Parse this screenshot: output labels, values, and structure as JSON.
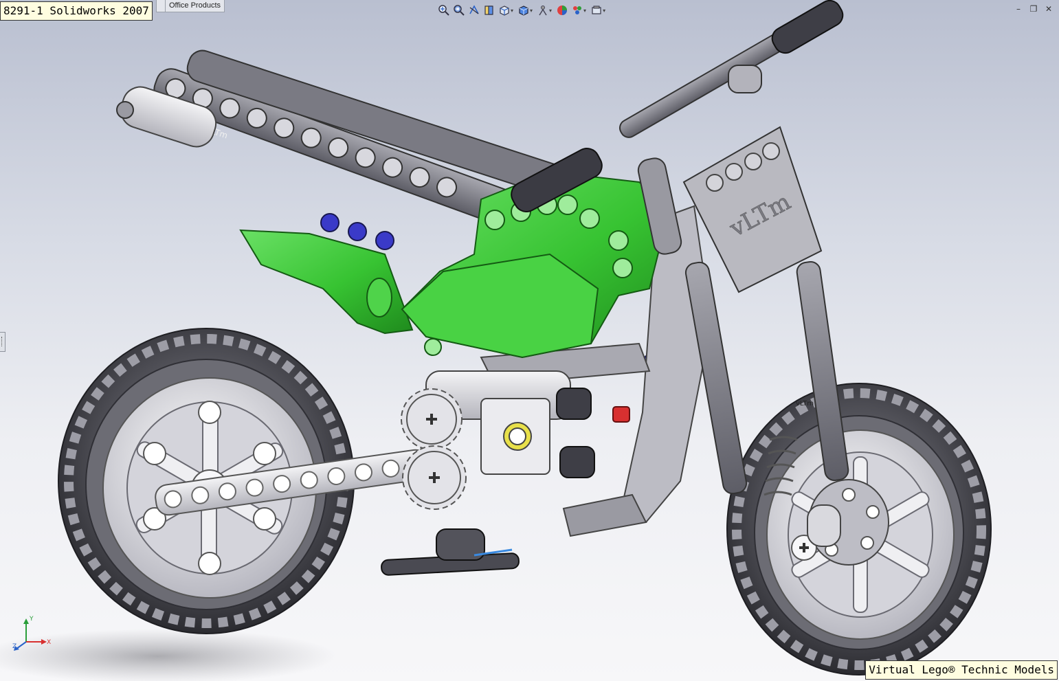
{
  "title_label": "8291-1 Solidworks 2007",
  "tabs": {
    "office_products": "Office Products"
  },
  "toolbar": {
    "icons": [
      "zoom-to-fit-icon",
      "zoom-area-icon",
      "previous-view-icon",
      "section-view-icon",
      "view-orientation-icon",
      "display-style-icon",
      "hide-show-icon",
      "edit-appearance-icon",
      "apply-scene-icon",
      "view-settings-icon"
    ]
  },
  "window": {
    "minimize": "–",
    "restore": "❐",
    "close": "✕"
  },
  "model": {
    "logo_text": "vLTm",
    "frame_text": "vLTm",
    "tire_text": "vLTm",
    "colors": {
      "green": "#3fcf3a",
      "green_dark": "#1f8a1d",
      "gray": "#8c8c94",
      "gray_dark": "#4e4e56",
      "steel": "#d9d9de",
      "blue_pin": "#3a3ac8",
      "red_part": "#d83030",
      "yellow_part": "#e8e04a"
    }
  },
  "triad": {
    "x": "X",
    "y": "Y",
    "z": "Z"
  },
  "watermark_label": "Virtual Lego® Technic Models"
}
